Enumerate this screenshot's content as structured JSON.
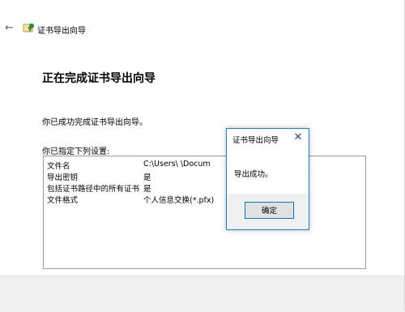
{
  "wizard": {
    "title": "证书导出向导",
    "heading": "正在完成证书导出向导",
    "success_text": "你已成功完成证书导出向导。",
    "settings_label": "你已指定下列设置:",
    "settings": [
      {
        "key": "文件名",
        "value": "C:\\Users\\        \\Docum"
      },
      {
        "key": "导出密钥",
        "value": "是"
      },
      {
        "key": "包括证书路径中的所有证书",
        "value": "是"
      },
      {
        "key": "文件格式",
        "value": "个人信息交换(*.pfx)"
      }
    ]
  },
  "dialog": {
    "title": "证书导出向导",
    "message": "导出成功。",
    "ok_label": "确定"
  },
  "icons": {
    "back": "←",
    "close": "✕"
  },
  "colors": {
    "dialog_border": "#1883d7",
    "button_border": "#0078d7"
  }
}
